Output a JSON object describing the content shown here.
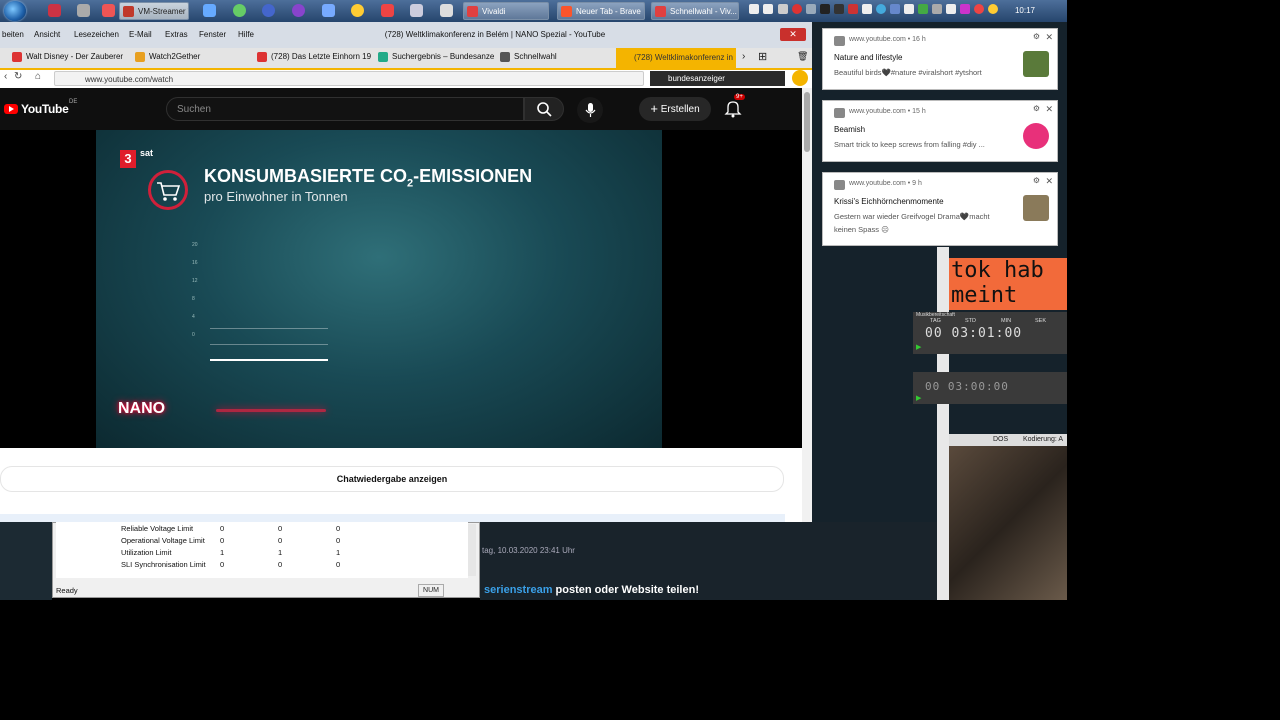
{
  "taskbar": {
    "tasks": [
      {
        "label": "VM-Streamer Vie...",
        "color": "#c0392b"
      },
      {
        "label": "Vivaldi",
        "color": "#e04040"
      },
      {
        "label": "Neuer Tab - Brave",
        "color": "#fb542b"
      },
      {
        "label": "Schnellwahl - Viv...",
        "color": "#e04040"
      }
    ],
    "clock": "10:17"
  },
  "browser": {
    "menu": [
      "beiten",
      "Ansicht",
      "Lesezeichen",
      "E-Mail",
      "Extras",
      "Fenster",
      "Hilfe"
    ],
    "window_title": "(728) Weltklimakonferenz in Belém | NANO Spezial - YouTube",
    "close": "✕",
    "bookmarks": [
      {
        "label": "Walt Disney - Der Zauberer",
        "color": "#d33"
      },
      {
        "label": "Watch2Gether",
        "color": "#e8a020"
      },
      {
        "label": "(728) Das Letzte Einhorn 19",
        "color": "#d33"
      },
      {
        "label": "Suchergebnis – Bundesanze",
        "color": "#2a8"
      },
      {
        "label": "Schnellwahl",
        "color": "#555"
      }
    ],
    "active_tab": "(728) Weltklimakonferenz in",
    "url": "www.youtube.com/watch",
    "search_value": "bundesanzeiger"
  },
  "youtube": {
    "logo": "YouTube",
    "region": "DE",
    "search_placeholder": "Suchen",
    "create_label": "Erstellen",
    "bell_badge": "9+",
    "chat_replay": "Chatwiedergabe anzeigen"
  },
  "video": {
    "channel": "3",
    "channel_suffix": "sat",
    "headline_pre": "KONSUMBASIERTE CO",
    "headline_sub": "2",
    "headline_post": "-EMISSIONEN",
    "subline": "pro Einwohner in Tonnen",
    "axis_ticks": [
      "20",
      "16",
      "12",
      "8",
      "4",
      "0"
    ],
    "nano_logo": "NANO"
  },
  "notifications": [
    {
      "source": "www.youtube.com",
      "time": "16 h",
      "title": "Nature and lifestyle",
      "body": "Beautiful birds🖤#nature #viralshort #ytshort",
      "thumb": "#5a7a3a"
    },
    {
      "source": "www.youtube.com",
      "time": "15 h",
      "title": "Beamish",
      "body": "Smart trick to keep screws from falling #diy ...",
      "thumb": "#e8307a"
    },
    {
      "source": "www.youtube.com",
      "time": "9 h",
      "title": "Krissi's Eichhörnchenmomente",
      "body": "Gestern war wieder Greifvogel Drama🖤macht keinen Spass ☹",
      "thumb": "#8a7a5a"
    }
  ],
  "right_panel": {
    "orange_text_1": "tok hab",
    "orange_text_2": "meint",
    "timer1": {
      "title": "Musikbereitschaft",
      "labels": [
        "TAG",
        "STD",
        "MIN",
        "SEK"
      ],
      "values": [
        "00",
        "03",
        "01",
        "00"
      ]
    },
    "timer2": {
      "values": [
        "00",
        "03",
        "00",
        "00"
      ]
    },
    "dos_label": "DOS",
    "encoding_label": "Kodierung: A"
  },
  "gpu": {
    "rows": [
      {
        "label": "Reliable Voltage Limit",
        "v": [
          "0",
          "0",
          "0"
        ]
      },
      {
        "label": "Operational Voltage Limit",
        "v": [
          "0",
          "0",
          "0"
        ]
      },
      {
        "label": "Utilization Limit",
        "v": [
          "1",
          "1",
          "1"
        ]
      },
      {
        "label": "SLI Synchronisation Limit",
        "v": [
          "0",
          "0",
          "0"
        ]
      }
    ],
    "status": "Ready",
    "num": "NUM"
  },
  "forum": {
    "date": "tag, 10.03.2020 23:41 Uhr",
    "link": "serienstream",
    "rest": " posten oder Website teilen!"
  }
}
